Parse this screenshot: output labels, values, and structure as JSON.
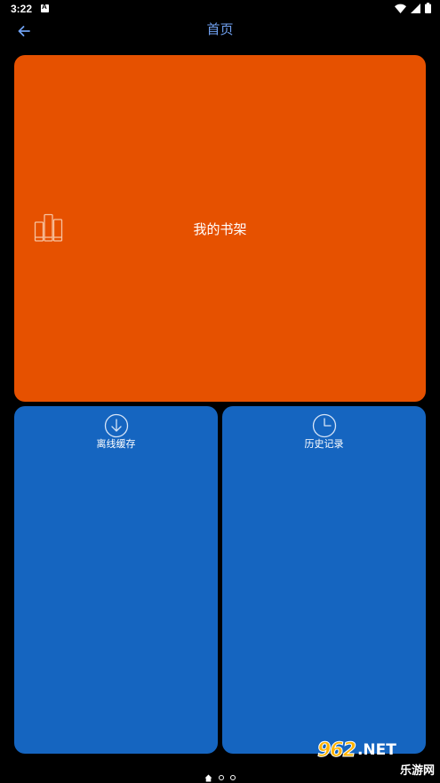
{
  "status_bar": {
    "time": "3:22",
    "icons": [
      "notification-a-icon",
      "wifi-icon",
      "signal-icon",
      "battery-icon"
    ]
  },
  "app_bar": {
    "title": "首页",
    "back_icon": "arrow-left-icon"
  },
  "tiles": {
    "bookshelf": {
      "label": "我的书架",
      "icon": "bookshelf-icon",
      "color": "#e65100"
    },
    "offline_cache": {
      "label": "离线缓存",
      "icon": "download-circle-icon",
      "color": "#1565c0"
    },
    "history": {
      "label": "历史记录",
      "icon": "clock-icon",
      "color": "#1565c0"
    }
  },
  "page_indicator": {
    "pages": [
      "home-icon",
      "dot",
      "dot"
    ],
    "current": 1
  },
  "watermark": {
    "number": "962",
    "domain": ".NET",
    "subtitle": "乐游网"
  }
}
